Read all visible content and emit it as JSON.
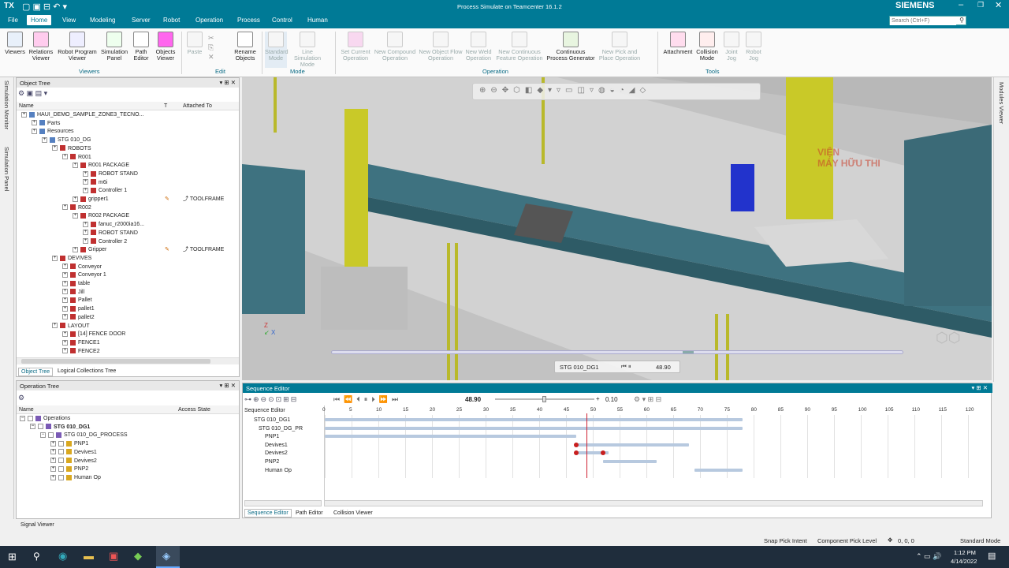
{
  "window": {
    "title": "Process Simulate on Teamcenter 16.1.2",
    "app_badge": "TX",
    "brand": "SIEMENS",
    "search_placeholder": "Search (Ctrl+F)"
  },
  "menu": {
    "items": [
      "File",
      "Home",
      "View",
      "Modeling",
      "Server",
      "Robot",
      "Operation",
      "Process",
      "Control",
      "Human"
    ],
    "active": "Home"
  },
  "ribbon": {
    "buttons": [
      {
        "label": "Viewers",
        "icon": "viewers-icon"
      },
      {
        "label": "Relations Viewer",
        "icon": "relations-icon"
      },
      {
        "label": "Robot Program Viewer",
        "icon": "robot-program-icon"
      },
      {
        "label": "Simulation Panel",
        "icon": "simulation-panel-icon"
      },
      {
        "label": "Path Editor",
        "icon": "path-editor-icon"
      },
      {
        "label": "Objects Viewer",
        "icon": "objects-viewer-icon"
      },
      {
        "label": "Paste",
        "icon": "paste-icon"
      },
      {
        "label": "Rename Objects",
        "icon": "rename-icon"
      },
      {
        "label": "Standard Mode",
        "icon": "standard-mode-icon"
      },
      {
        "label": "Line Simulation Mode",
        "icon": "line-sim-icon"
      },
      {
        "label": "Set Current Operation",
        "icon": "set-current-op-icon"
      },
      {
        "label": "New Compound Operation",
        "icon": "compound-op-icon"
      },
      {
        "label": "New Object Flow Operation",
        "icon": "object-flow-icon"
      },
      {
        "label": "New Weld Operation",
        "icon": "weld-op-icon"
      },
      {
        "label": "New Continuous Feature Operation",
        "icon": "continuous-feature-icon"
      },
      {
        "label": "Continuous Process Generator",
        "icon": "cpg-icon"
      },
      {
        "label": "New Pick and Place Operation",
        "icon": "pick-place-icon"
      },
      {
        "label": "Attachment",
        "icon": "attachment-icon"
      },
      {
        "label": "Collision Mode",
        "icon": "collision-icon"
      },
      {
        "label": "Joint Jog",
        "icon": "joint-jog-icon"
      },
      {
        "label": "Robot Jog",
        "icon": "robot-jog-icon"
      }
    ],
    "groups": [
      "Viewers",
      "Edit",
      "Mode",
      "Operation",
      "Tools"
    ]
  },
  "object_tree": {
    "title": "Object Tree",
    "columns": [
      "Name",
      "T",
      "Attached To"
    ],
    "rows": [
      {
        "label": "HAUI_DEMO_SAMPLE_ZONE3_TECNO...",
        "level": 0
      },
      {
        "label": "Parts",
        "level": 1
      },
      {
        "label": "Resources",
        "level": 1
      },
      {
        "label": "STG 010_DG",
        "level": 2
      },
      {
        "label": "ROBOTS",
        "level": 3
      },
      {
        "label": "R001",
        "level": 4
      },
      {
        "label": "R001 PACKAGE",
        "level": 5
      },
      {
        "label": "ROBOT STAND",
        "level": 6
      },
      {
        "label": "m6i",
        "level": 6
      },
      {
        "label": "Controller 1",
        "level": 6
      },
      {
        "label": "gripper1",
        "level": 5,
        "attached": "TOOLFRAME"
      },
      {
        "label": "R002",
        "level": 4
      },
      {
        "label": "R002 PACKAGE",
        "level": 5
      },
      {
        "label": "fanuc_r2000ia16...",
        "level": 6
      },
      {
        "label": "ROBOT STAND",
        "level": 6
      },
      {
        "label": "Controller 2",
        "level": 6
      },
      {
        "label": "Gripper",
        "level": 5,
        "attached": "TOOLFRAME"
      },
      {
        "label": "DEVIVES",
        "level": 3
      },
      {
        "label": "Conveyor",
        "level": 4
      },
      {
        "label": "Conveyor 1",
        "level": 4
      },
      {
        "label": "table",
        "level": 4
      },
      {
        "label": "Jill",
        "level": 4
      },
      {
        "label": "Pallet",
        "level": 4
      },
      {
        "label": "pallet1",
        "level": 4
      },
      {
        "label": "pallet2",
        "level": 4
      },
      {
        "label": "LAYOUT",
        "level": 3
      },
      {
        "label": "[14] FENCE DOOR",
        "level": 4
      },
      {
        "label": "FENCE1",
        "level": 4
      },
      {
        "label": "FENCE2",
        "level": 4
      }
    ],
    "tabs": [
      "Object Tree",
      "Logical Collections Tree"
    ]
  },
  "operation_tree": {
    "title": "Operation Tree",
    "columns": [
      "Name",
      "Access State"
    ],
    "rows": [
      {
        "label": "Operations",
        "level": 0
      },
      {
        "label": "STG 010_DG1",
        "level": 1
      },
      {
        "label": "STG 010_DG_PROCESS",
        "level": 2
      },
      {
        "label": "PNP1",
        "level": 3
      },
      {
        "label": "Devives1",
        "level": 3
      },
      {
        "label": "Devives2",
        "level": 3
      },
      {
        "label": "PNP2",
        "level": 3
      },
      {
        "label": "Human Op",
        "level": 3
      }
    ]
  },
  "side_tabs": {
    "left": [
      "Simulation Monitor",
      "Simulation Panel"
    ],
    "right": "Modules Viewer"
  },
  "viewport": {
    "overlay_op": "STG 010_DG1",
    "overlay_time": "48.90",
    "watermark_line1": "VIỆN",
    "watermark_line2": "MÁY HỮU THI"
  },
  "sequence_editor": {
    "title": "Sequence Editor",
    "time": "48.90",
    "step": "0.10",
    "column_label": "Sequence Editor",
    "ticks": [
      "0",
      "5",
      "10",
      "15",
      "20",
      "25",
      "30",
      "35",
      "40",
      "45",
      "50",
      "55",
      "60",
      "65",
      "70",
      "75",
      "80",
      "85",
      "90",
      "95",
      "100",
      "105",
      "110",
      "115",
      "120"
    ],
    "rows": [
      "STG 010_DG1",
      "STG 010_DG_PR",
      "PNP1",
      "Devives1",
      "Devives2",
      "PNP2",
      "Human Op"
    ],
    "bars": [
      {
        "row": 0,
        "start": 0,
        "end": 78
      },
      {
        "row": 1,
        "start": 0,
        "end": 78
      },
      {
        "row": 2,
        "start": 0,
        "end": 47
      },
      {
        "row": 3,
        "start": 47,
        "end": 68
      },
      {
        "row": 4,
        "start": 47,
        "end": 53
      },
      {
        "row": 5,
        "start": 52,
        "end": 62
      },
      {
        "row": 6,
        "start": 69,
        "end": 78
      }
    ],
    "cursor": 48.9,
    "tabs": [
      "Sequence Editor",
      "Path Editor",
      "Collision Viewer"
    ]
  },
  "signal_viewer": "Signal Viewer",
  "status": {
    "snap": "Snap Pick Intent",
    "pick_level": "Component Pick Level",
    "coords": "0, 0, 0",
    "mode": "Standard Mode"
  },
  "taskbar": {
    "time": "1:12 PM",
    "date": "4/14/2022"
  }
}
